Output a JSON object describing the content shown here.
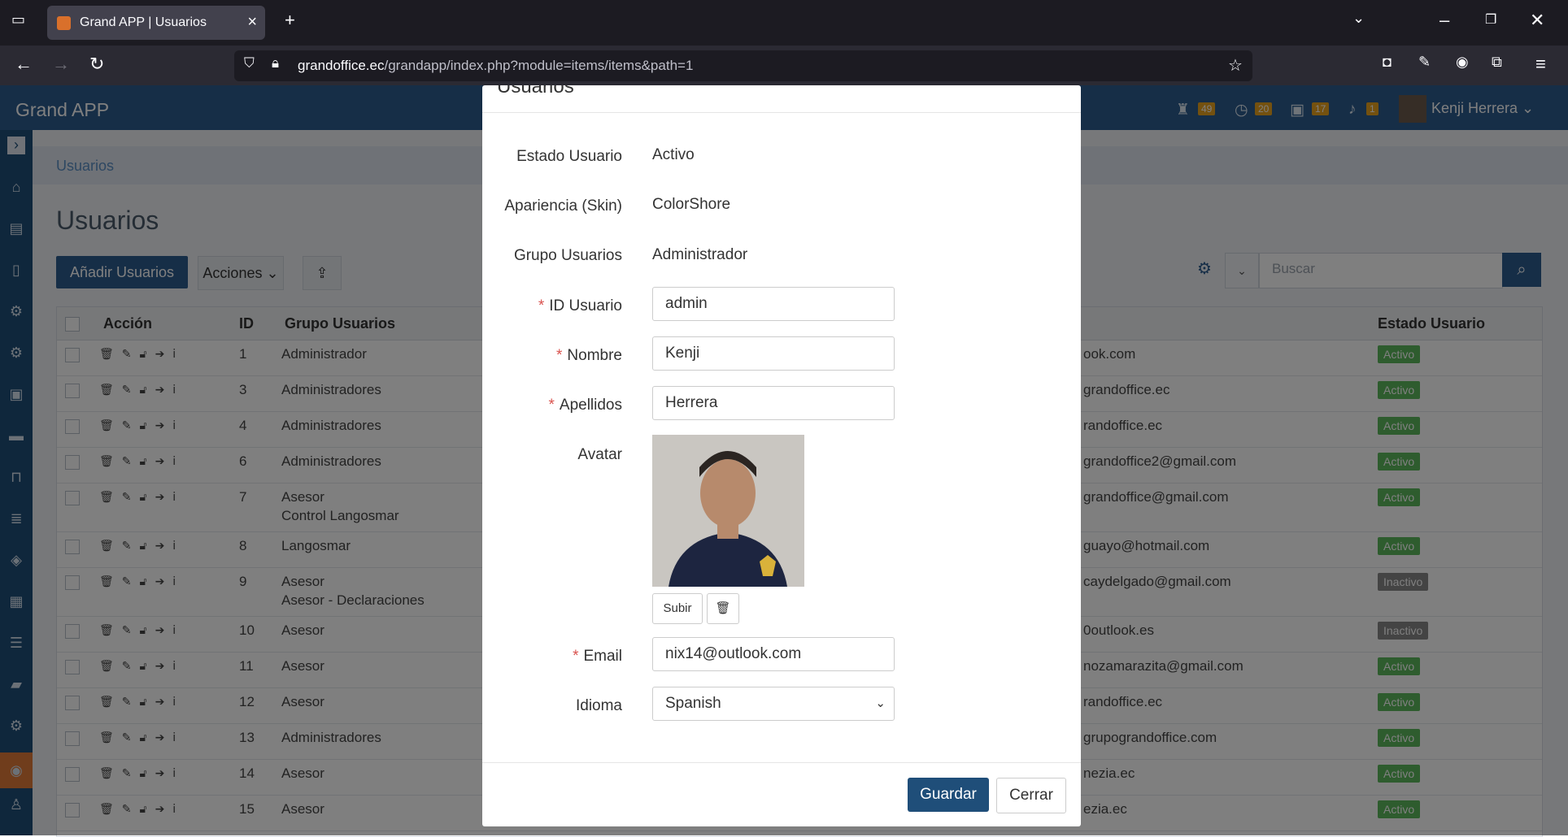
{
  "browser": {
    "tab_title": "Grand APP | Usuarios",
    "url_host": "grandoffice.ec",
    "url_path": "/grandapp/index.php?module=items/items&path=1"
  },
  "app": {
    "brand": "Grand APP",
    "badges": [
      "49",
      "20",
      "17",
      "1"
    ],
    "user_name": "Kenji Herrera"
  },
  "page": {
    "breadcrumb": "Usuarios",
    "title": "Usuarios",
    "add_button": "Añadir Usuarios",
    "actions_button": "Acciones",
    "search_placeholder": "Buscar"
  },
  "table": {
    "headers": {
      "accion": "Acción",
      "id": "ID",
      "grupo": "Grupo Usuarios",
      "estado": "Estado Usuario"
    },
    "rows": [
      {
        "id": "1",
        "group": "Administrador",
        "group2": "",
        "email": "ook.com",
        "status": "Activo"
      },
      {
        "id": "3",
        "group": "Administradores",
        "group2": "",
        "email": "grandoffice.ec",
        "status": "Activo"
      },
      {
        "id": "4",
        "group": "Administradores",
        "group2": "",
        "email": "randoffice.ec",
        "status": "Activo"
      },
      {
        "id": "6",
        "group": "Administradores",
        "group2": "",
        "email": "grandoffice2@gmail.com",
        "status": "Activo"
      },
      {
        "id": "7",
        "group": "Asesor",
        "group2": "Control Langosmar",
        "email": "grandoffice@gmail.com",
        "status": "Activo"
      },
      {
        "id": "8",
        "group": "Langosmar",
        "group2": "",
        "email": "guayo@hotmail.com",
        "status": "Activo"
      },
      {
        "id": "9",
        "group": "Asesor",
        "group2": "Asesor - Declaraciones",
        "email": "caydelgado@gmail.com",
        "status": "Inactivo"
      },
      {
        "id": "10",
        "group": "Asesor",
        "group2": "",
        "email": "0outlook.es",
        "status": "Inactivo"
      },
      {
        "id": "11",
        "group": "Asesor",
        "group2": "",
        "email": "nozamarazita@gmail.com",
        "status": "Activo"
      },
      {
        "id": "12",
        "group": "Asesor",
        "group2": "",
        "email": "randoffice.ec",
        "status": "Activo"
      },
      {
        "id": "13",
        "group": "Administradores",
        "group2": "",
        "email": "grupograndoffice.com",
        "status": "Activo"
      },
      {
        "id": "14",
        "group": "Asesor",
        "group2": "",
        "email": "nezia.ec",
        "status": "Activo"
      },
      {
        "id": "15",
        "group": "Asesor",
        "group2": "",
        "email": "ezia.ec",
        "status": "Activo"
      }
    ]
  },
  "modal": {
    "title": "Usuarios",
    "fields": {
      "estado_label": "Estado Usuario",
      "estado_value": "Activo",
      "skin_label": "Apariencia (Skin)",
      "skin_value": "ColorShore",
      "grupo_label": "Grupo Usuarios",
      "grupo_value": "Administrador",
      "id_label": "ID Usuario",
      "id_value": "admin",
      "nombre_label": "Nombre",
      "nombre_value": "Kenji",
      "apellidos_label": "Apellidos",
      "apellidos_value": "Herrera",
      "avatar_label": "Avatar",
      "email_label": "Email",
      "email_value": "nix14@outlook.com",
      "idioma_label": "Idioma",
      "idioma_value": "Spanish"
    },
    "upload_button": "Subir",
    "save_button": "Guardar",
    "close_button": "Cerrar"
  },
  "colors": {
    "primary": "#2c5c8f",
    "active": "#5cb85c",
    "inactive": "#888888",
    "badge": "#e9a21f"
  }
}
